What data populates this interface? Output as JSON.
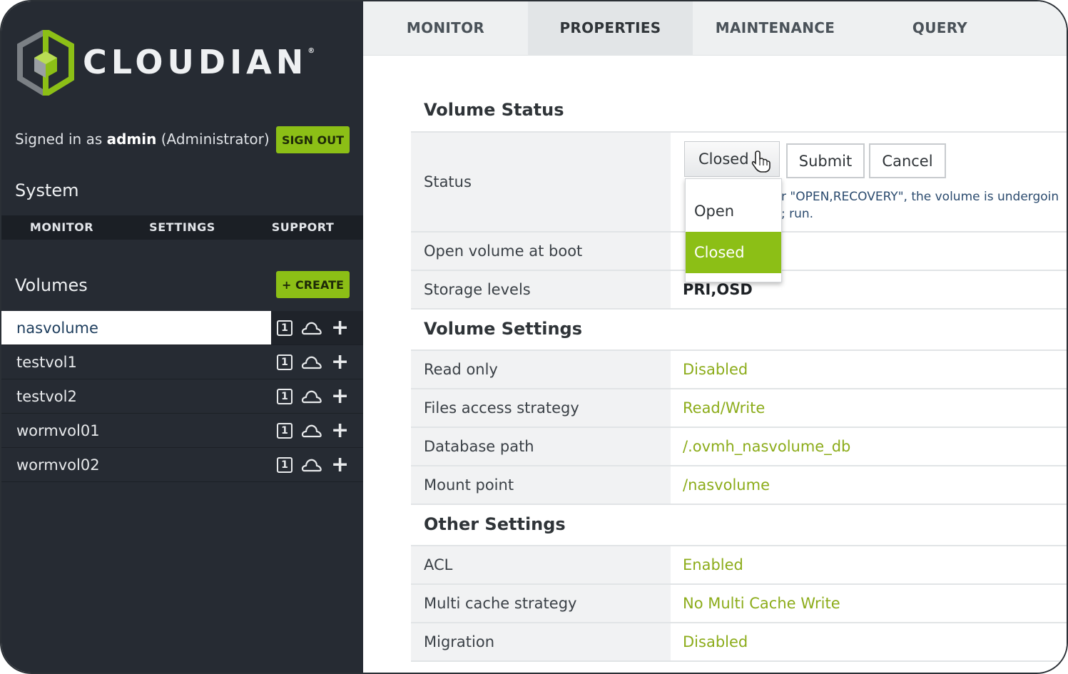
{
  "brand": {
    "name": "CLOUDIAN",
    "reg": "®"
  },
  "user": {
    "prefix": "Signed in as ",
    "name": "admin",
    "role": "(Administrator)"
  },
  "sidebar": {
    "signout_label": "SIGN OUT",
    "system_title": "System",
    "subnav": [
      "MONITOR",
      "SETTINGS",
      "SUPPORT"
    ],
    "volumes_title": "Volumes",
    "create_label": "+ CREATE",
    "volumes": [
      {
        "name": "nasvolume",
        "active": true
      },
      {
        "name": "testvol1",
        "active": false
      },
      {
        "name": "testvol2",
        "active": false
      },
      {
        "name": "wormvol01",
        "active": false
      },
      {
        "name": "wormvol02",
        "active": false
      }
    ],
    "volume_icon_label": "1"
  },
  "tabs": [
    {
      "label": "MONITOR",
      "active": false
    },
    {
      "label": "PROPERTIES",
      "active": true
    },
    {
      "label": "MAINTENANCE",
      "active": false
    },
    {
      "label": "QUERY",
      "active": false
    }
  ],
  "volume_status": {
    "title": "Volume Status",
    "status_label": "Status",
    "status_value": "Closed",
    "submit_label": "Submit",
    "cancel_label": "Cancel",
    "help_line1": "r \"OPEN,RECOVERY\", the volume is undergoin",
    "help_line2": "; run.",
    "dropdown_options": [
      "Open",
      "Closed"
    ],
    "dropdown_selected": "Closed",
    "open_at_boot_label": "Open volume at boot",
    "storage_levels_label": "Storage levels",
    "storage_levels_value": "PRI,OSD"
  },
  "volume_settings": {
    "title": "Volume Settings",
    "rows": [
      {
        "label": "Read only",
        "value": "Disabled"
      },
      {
        "label": "Files access strategy",
        "value": "Read/Write"
      },
      {
        "label": "Database path",
        "value": "/.ovmh_nasvolume_db"
      },
      {
        "label": "Mount point",
        "value": "/nasvolume"
      }
    ]
  },
  "other_settings": {
    "title": "Other Settings",
    "rows": [
      {
        "label": "ACL",
        "value": "Enabled"
      },
      {
        "label": "Multi cache strategy",
        "value": "No Multi Cache Write"
      },
      {
        "label": "Migration",
        "value": "Disabled"
      }
    ]
  },
  "colors": {
    "accent": "#8cbf16",
    "sidebar_bg": "#262b33",
    "value_green": "#8cac1a"
  }
}
